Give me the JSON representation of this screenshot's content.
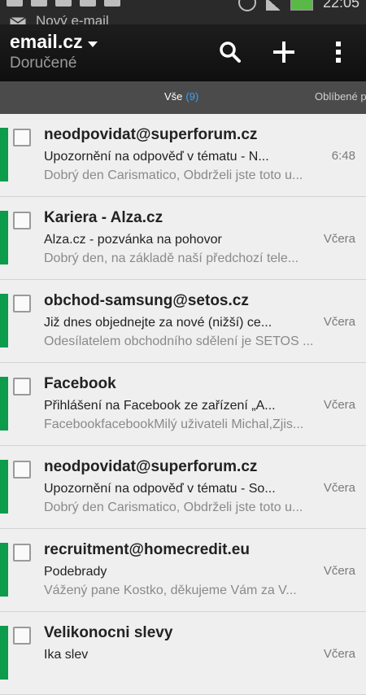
{
  "status_bar": {
    "notification": "Nový e-mail",
    "time": "22:05"
  },
  "header": {
    "account": "email.cz",
    "folder": "Doručené",
    "icons": [
      "search-icon",
      "add-icon",
      "more-icon"
    ]
  },
  "tabs": {
    "all_label": "Vše",
    "all_count": "(9)",
    "favorites_label": "Oblíbené položky"
  },
  "colors": {
    "unread_marker": "#0d9b4c",
    "tab_count": "#3aa0ff"
  },
  "messages": [
    {
      "sender": "neodpovidat@superforum.cz",
      "subject": "Upozornění na odpověď v tématu - N...",
      "preview": "Dobrý den Carismatico,  Obdrželi jste toto u...",
      "time": "6:48"
    },
    {
      "sender": "Kariera - Alza.cz",
      "subject": "Alza.cz - pozvánka na pohovor",
      "preview": "Dobrý den,    na základě naší předchozí tele...",
      "time": "Včera"
    },
    {
      "sender": "obchod-samsung@setos.cz",
      "subject": "Již dnes objednejte za nové (nižší) ce...",
      "preview": "Odesílatelem obchodního sdělení je SETOS ...",
      "time": "Včera"
    },
    {
      "sender": "Facebook",
      "subject": "Přihlášení na Facebook ze zařízení „A...",
      "preview": "FacebookfacebookMilý uživateli Michal,Zjis...",
      "time": "Včera"
    },
    {
      "sender": "neodpovidat@superforum.cz",
      "subject": "Upozornění na odpověď v tématu - So...",
      "preview": "Dobrý den Carismatico,  Obdrželi jste toto u...",
      "time": "Včera"
    },
    {
      "sender": "recruitment@homecredit.eu",
      "subject": " Podebrady",
      "preview": "Vážený pane Kostko,   děkujeme Vám za V...",
      "time": "Včera"
    },
    {
      "sender": "Velikonocni slevy",
      "subject": "Ika slev",
      "preview": "",
      "time": "Včera"
    }
  ]
}
